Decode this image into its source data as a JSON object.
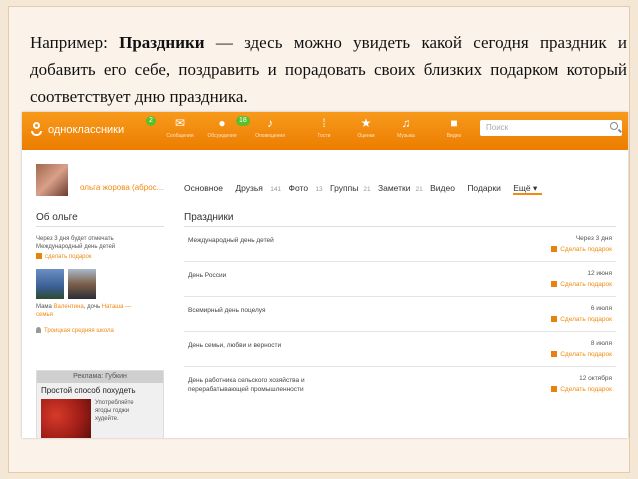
{
  "slide": {
    "lead": "Например: ",
    "bold": "Праздники",
    "rest": " — здесь можно увидеть какой сегодня праздник и добавить его себе, поздравить и порадовать своих близких подарком который соответствует дню праздника."
  },
  "topbar": {
    "logo_text": "одноклассники",
    "logo_badge": "2",
    "nav": [
      {
        "label": "Сообщения",
        "icon": "envelope-icon",
        "glyph": "✉"
      },
      {
        "label": "Обсуждения",
        "icon": "chat-icon",
        "glyph": "●",
        "badge": "18"
      },
      {
        "label": "Оповещения",
        "icon": "bell-icon",
        "glyph": "♪"
      },
      {
        "label": "Гости",
        "icon": "footprints-icon",
        "glyph": "⁞"
      },
      {
        "label": "Оценки",
        "icon": "rating-icon",
        "glyph": "★"
      },
      {
        "label": "Музыка",
        "icon": "music-icon",
        "glyph": "♫"
      },
      {
        "label": "Видео",
        "icon": "video-icon",
        "glyph": "■"
      }
    ],
    "search_placeholder": "Поиск"
  },
  "profile": {
    "username": "ольга жорова (аброс...",
    "tabs": [
      {
        "label": "Основное"
      },
      {
        "label": "Друзья",
        "count": "141"
      },
      {
        "label": "Фото",
        "count": "13"
      },
      {
        "label": "Группы",
        "count": "21"
      },
      {
        "label": "Заметки",
        "count": "21"
      },
      {
        "label": "Видео"
      },
      {
        "label": "Подарки"
      },
      {
        "label": "Ещё ▾"
      }
    ]
  },
  "about": {
    "title": "Об ольге",
    "notice_line1": "Через 3 дня будет отмечать",
    "notice_line2": "Международный день детей",
    "gift_link": "сделать подарок",
    "family_prefix": "Мама ",
    "family_mother": "Валентина",
    "family_mid": ", дочь ",
    "family_daughter": "Наташа —",
    "family_suffix": "семья",
    "school": "Троицкая средняя школа"
  },
  "ad": {
    "header": "Реклама: Губкин",
    "title": "Простой способ похудеть",
    "text_line1": "Употребляйте",
    "text_line2": "ягоды годжи",
    "text_line3": "худейте."
  },
  "holidays": {
    "title": "Праздники",
    "gift_label": "Сделать подарок",
    "items": [
      {
        "name_line1": "Международный день детей",
        "name_line2": "",
        "date": "Через 3 дня"
      },
      {
        "name_line1": "День России",
        "name_line2": "",
        "date": "12 июня"
      },
      {
        "name_line1": "Всемирный день поцелуя",
        "name_line2": "",
        "date": "6 июля"
      },
      {
        "name_line1": "День семьи, любви и верности",
        "name_line2": "",
        "date": "8 июля"
      },
      {
        "name_line1": "День работника сельского хозяйства и",
        "name_line2": "перерабатывающей промышленности",
        "date": "12 октября"
      }
    ]
  }
}
